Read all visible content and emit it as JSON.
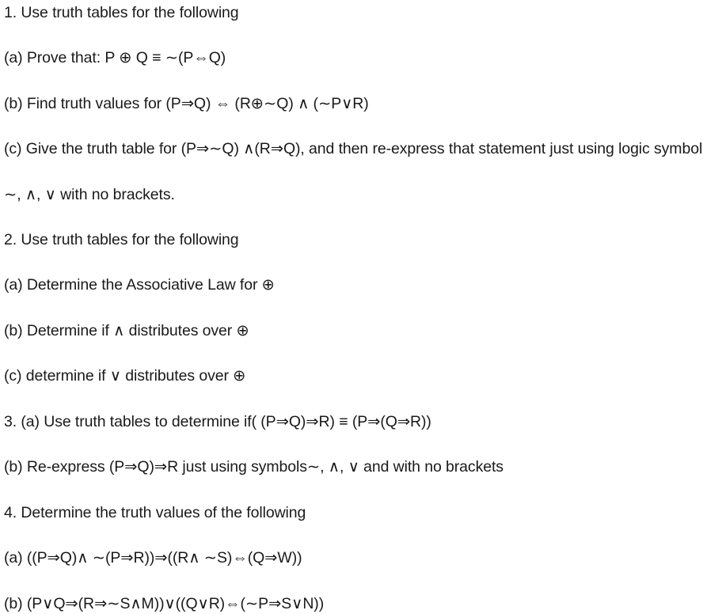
{
  "document": {
    "type": "logic-worksheet",
    "background_color": "#ffffff",
    "text_color": "#1a1a1a"
  },
  "symbols": {
    "xor": "⊕",
    "equiv": "≡",
    "not": "∼",
    "iff": "⇔",
    "implies": "⇒",
    "and": "∧",
    "or": "∨"
  },
  "lines": [
    {
      "id": "q1-heading",
      "text": "1. Use truth tables for the following"
    },
    {
      "id": "q1a",
      "text": "(a) Prove that: P ⊕ Q ≡ ∼(P⇔Q)"
    },
    {
      "id": "q1b",
      "text": "(b) Find truth values for (P⇒Q) ⇔ (R⊕∼Q) ∧ (∼P∨R)"
    },
    {
      "id": "q1c",
      "text": "(c) Give the truth table for (P⇒∼Q) ∧(R⇒Q), and then re-express that statement just using logic symbols"
    },
    {
      "id": "q1c-cont",
      "text": "∼, ∧, ∨ with no brackets."
    },
    {
      "id": "q2-heading",
      "text": "2. Use truth tables for the following"
    },
    {
      "id": "q2a",
      "text": "(a) Determine the Associative Law for ⊕"
    },
    {
      "id": "q2b",
      "text": "(b) Determine if ∧ distributes over ⊕"
    },
    {
      "id": "q2c",
      "text": "(c) determine if ∨ distributes over ⊕"
    },
    {
      "id": "q3a",
      "text": "3. (a) Use truth tables to determine if( (P⇒Q)⇒R) ≡ (P⇒(Q⇒R))"
    },
    {
      "id": "q3b",
      "text": "(b) Re-express (P⇒Q)⇒R just using symbols∼, ∧, ∨ and with no brackets"
    },
    {
      "id": "q4-heading",
      "text": "4. Determine the truth values of the following"
    },
    {
      "id": "q4a",
      "text": "(a)  ((P⇒Q)∧ ∼(P⇒R))⇒((R∧ ∼S)⇔(Q⇒W))"
    },
    {
      "id": "q4b",
      "text": "(b)  (P∨Q⇒(R⇒∼S∧M))∨((Q∨R)⇔(∼P⇒S∨N))"
    }
  ]
}
